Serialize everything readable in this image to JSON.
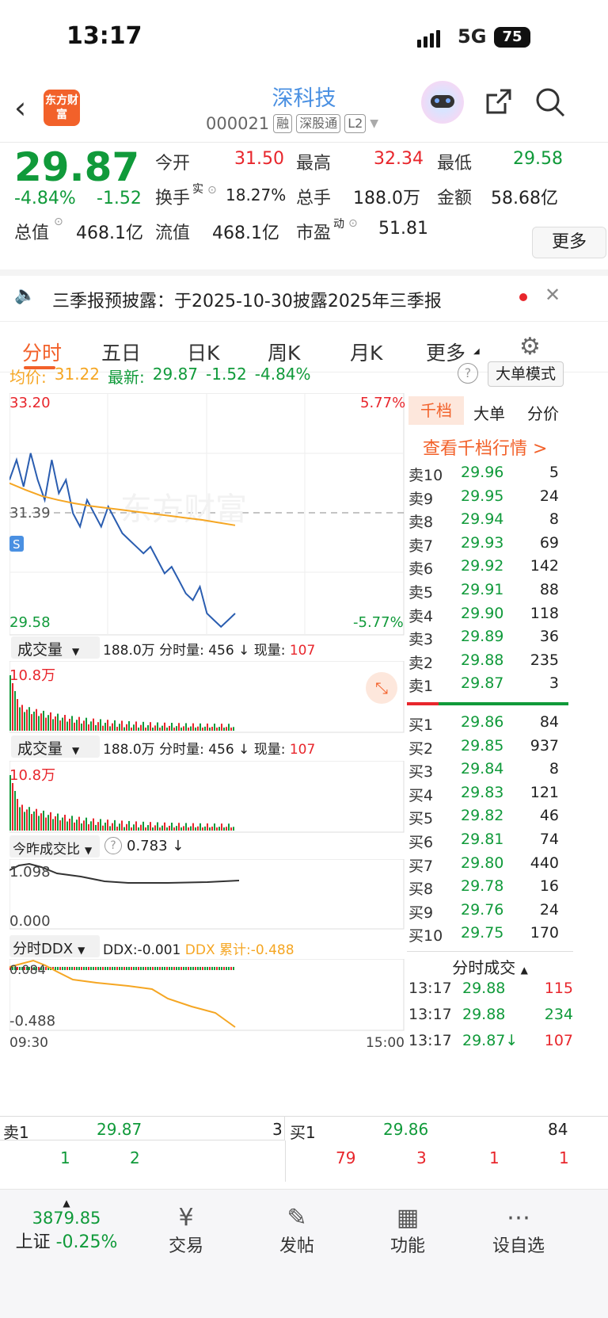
{
  "status": {
    "time": "13:17",
    "network": "5G",
    "battery": "75"
  },
  "nav": {
    "title": "深科技",
    "code": "000021",
    "tags": [
      "融",
      "深股通",
      "L2"
    ],
    "logo": "东方财富"
  },
  "quote": {
    "price": "29.87",
    "change_pct": "-4.84%",
    "change": "-1.52",
    "open_label": "今开",
    "open": "31.50",
    "high_label": "最高",
    "high": "32.34",
    "low_label": "最低",
    "low": "29.58",
    "turnover_label": "换手",
    "turnover_sup": "实",
    "turnover": "18.27%",
    "volume_label": "总手",
    "volume": "188.0万",
    "amount_label": "金额",
    "amount": "58.68亿",
    "mcap_label": "总值",
    "mcap": "468.1亿",
    "float_label": "流值",
    "float": "468.1亿",
    "pe_label": "市盈",
    "pe_sup": "动",
    "pe": "51.81",
    "more": "更多"
  },
  "notice": {
    "text": "三季报预披露：于2025-10-30披露2025年三季报"
  },
  "tabs": [
    "分时",
    "五日",
    "日K",
    "周K",
    "月K",
    "更多"
  ],
  "avg_line": {
    "avg_label": "均价:",
    "avg": "31.22",
    "latest_label": "最新:",
    "latest": "29.87",
    "chg": "-1.52",
    "pct": "-4.84%",
    "mode": "大单模式"
  },
  "chart": {
    "y_top": "33.20",
    "y_mid": "31.39",
    "y_bottom": "29.58",
    "pct_top": "5.77%",
    "pct_bottom": "-5.77%",
    "watermark": "东方财富",
    "vol_label": "成交量",
    "vol_total": "188.0万",
    "vol_info": "分时量: 456 ↓ 现量:",
    "vol_now": "107",
    "vol_max": "10.8万",
    "ratio_label": "今昨成交比",
    "ratio_val": "0.783 ↓",
    "ratio_top": "1.098",
    "ratio_bottom": "0.000",
    "ddx_label": "分时DDX",
    "ddx_val": "DDX:-0.001",
    "ddx_sum": "DDX 累计:-0.488",
    "ddx_top": "0.084",
    "ddx_bottom": "-0.488",
    "t_start": "09:30",
    "t_end": "15:00"
  },
  "chart_data": {
    "type": "line",
    "series": [
      {
        "values": [
          31.9,
          32.2,
          31.8,
          32.3,
          31.9,
          31.6,
          32.2,
          31.7,
          31.9,
          31.4,
          31.2,
          31.6,
          31.4,
          31.2,
          31.5,
          31.3,
          31.1,
          31.0,
          30.9,
          30.8,
          30.9,
          30.7,
          30.5,
          30.6,
          30.4,
          30.2,
          30.1,
          30.3,
          29.9,
          29.8,
          29.7,
          29.8,
          29.9
        ]
      },
      {
        "values": [
          31.85,
          31.75,
          31.66,
          31.6,
          31.55,
          31.51,
          31.48,
          31.45,
          31.42,
          31.39,
          31.36,
          31.33,
          31.3,
          31.26,
          31.22
        ]
      }
    ],
    "ylim": [
      29.58,
      33.2
    ]
  },
  "orderbook": {
    "tabs": [
      "千档",
      "大单",
      "分价"
    ],
    "link": "查看千档行情 >",
    "sell": [
      [
        "卖10",
        "29.96",
        "5"
      ],
      [
        "卖9",
        "29.95",
        "24"
      ],
      [
        "卖8",
        "29.94",
        "8"
      ],
      [
        "卖7",
        "29.93",
        "69"
      ],
      [
        "卖6",
        "29.92",
        "142"
      ],
      [
        "卖5",
        "29.91",
        "88"
      ],
      [
        "卖4",
        "29.90",
        "118"
      ],
      [
        "卖3",
        "29.89",
        "36"
      ],
      [
        "卖2",
        "29.88",
        "235"
      ],
      [
        "卖1",
        "29.87",
        "3"
      ]
    ],
    "buy": [
      [
        "买1",
        "29.86",
        "84"
      ],
      [
        "买2",
        "29.85",
        "937"
      ],
      [
        "买3",
        "29.84",
        "8"
      ],
      [
        "买4",
        "29.83",
        "121"
      ],
      [
        "买5",
        "29.82",
        "46"
      ],
      [
        "买6",
        "29.81",
        "74"
      ],
      [
        "买7",
        "29.80",
        "440"
      ],
      [
        "买8",
        "29.78",
        "16"
      ],
      [
        "买9",
        "29.76",
        "24"
      ],
      [
        "买10",
        "29.75",
        "170"
      ]
    ],
    "trades_title": "分时成交",
    "trades": [
      [
        "13:17",
        "29.88",
        "115"
      ],
      [
        "13:17",
        "29.88",
        "234"
      ],
      [
        "13:17",
        "29.87↓",
        "107"
      ]
    ]
  },
  "bottom": {
    "sell_label": "卖1",
    "sell_price": "29.87",
    "sell_vol": "3",
    "buy_label": "买1",
    "buy_price": "29.86",
    "buy_vol": "84",
    "sell_q": [
      "1",
      "2"
    ],
    "buy_q": [
      "79",
      "3",
      "1",
      "1"
    ]
  },
  "footer": {
    "index_val": "3879.85",
    "index_name": "上证",
    "index_pct": "-0.25%",
    "trade": "交易",
    "post": "发帖",
    "func": "功能",
    "watch": "设自选"
  }
}
